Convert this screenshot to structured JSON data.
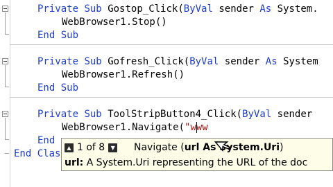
{
  "editor": {
    "block1": {
      "line1": {
        "private": "Private",
        "sub": "Sub",
        "name": "Gostop_Click(",
        "byval": "ByVal",
        "param": " sender ",
        "as": "As",
        "type": " System."
      },
      "line2": "WebBrowser1.Stop()",
      "line3": {
        "end": "End",
        "sub": "Sub"
      }
    },
    "block2": {
      "line1": {
        "private": "Private",
        "sub": "Sub",
        "name": "Gofresh_Click(",
        "byval": "ByVal",
        "param": " sender ",
        "as": "As",
        "type": " System"
      },
      "line2": "WebBrowser1.Refresh()",
      "line3": {
        "end": "End",
        "sub": "Sub"
      }
    },
    "block3": {
      "line1": {
        "private": "Private",
        "sub": "Sub",
        "name": "ToolStripButton4_Click(",
        "byval": "ByVal",
        "param": " sender"
      },
      "line2": {
        "code": "WebBrowser1.Navigate(",
        "string": "\"www"
      },
      "line3": {
        "end": "End"
      }
    },
    "class_end": {
      "end": "End",
      "class": "Clas"
    }
  },
  "tooltip": {
    "count": "1 of 8",
    "method": "Navigate (",
    "param_sig": "url As System.Uri",
    "close": ")",
    "param_name": "url:",
    "description": " A System.Uri representing the URL of the doc"
  },
  "icons": {
    "prev": "triangle-up-icon",
    "next": "triangle-down-icon",
    "cursor": "mouse-pointer-icon"
  },
  "colors": {
    "keyword": "#1c3ccf",
    "string": "#a31515",
    "tooltip_bg": "#fefee8"
  }
}
